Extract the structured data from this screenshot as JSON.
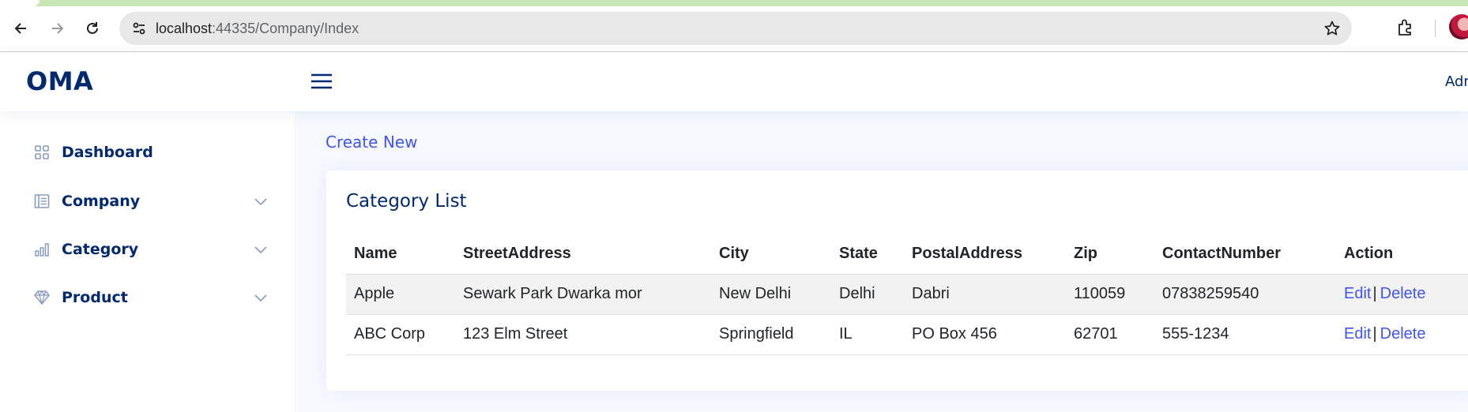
{
  "browser": {
    "url_host": "localhost",
    "url_rest": ":44335/Company/Index"
  },
  "header": {
    "logo": "OMA",
    "user": "Admin"
  },
  "sidebar": {
    "items": [
      {
        "label": "Dashboard",
        "icon": "grid-icon",
        "has_chevron": false
      },
      {
        "label": "Company",
        "icon": "layout-text-icon",
        "has_chevron": true
      },
      {
        "label": "Category",
        "icon": "bar-chart-icon",
        "has_chevron": true
      },
      {
        "label": "Product",
        "icon": "gem-icon",
        "has_chevron": true
      }
    ]
  },
  "main": {
    "create_link": "Create New",
    "card_title": "Category List",
    "table": {
      "columns": [
        "Name",
        "StreetAddress",
        "City",
        "State",
        "PostalAddress",
        "Zip",
        "ContactNumber",
        "Action"
      ],
      "rows": [
        {
          "name": "Apple",
          "street": "Sewark Park Dwarka mor",
          "city": "New Delhi",
          "state": "Delhi",
          "postal": "Dabri",
          "zip": "110059",
          "contact": "07838259540",
          "edit": "Edit",
          "sep": "|",
          "delete": "Delete"
        },
        {
          "name": "ABC Corp",
          "street": "123 Elm Street",
          "city": "Springfield",
          "state": "IL",
          "postal": "PO Box 456",
          "zip": "62701",
          "contact": "555-1234",
          "edit": "Edit",
          "sep": "|",
          "delete": "Delete"
        }
      ]
    }
  },
  "colors": {
    "brand": "#012970",
    "link": "#4154f1",
    "main_bg": "#f6f9ff",
    "stripe": "#f2f2f2"
  }
}
